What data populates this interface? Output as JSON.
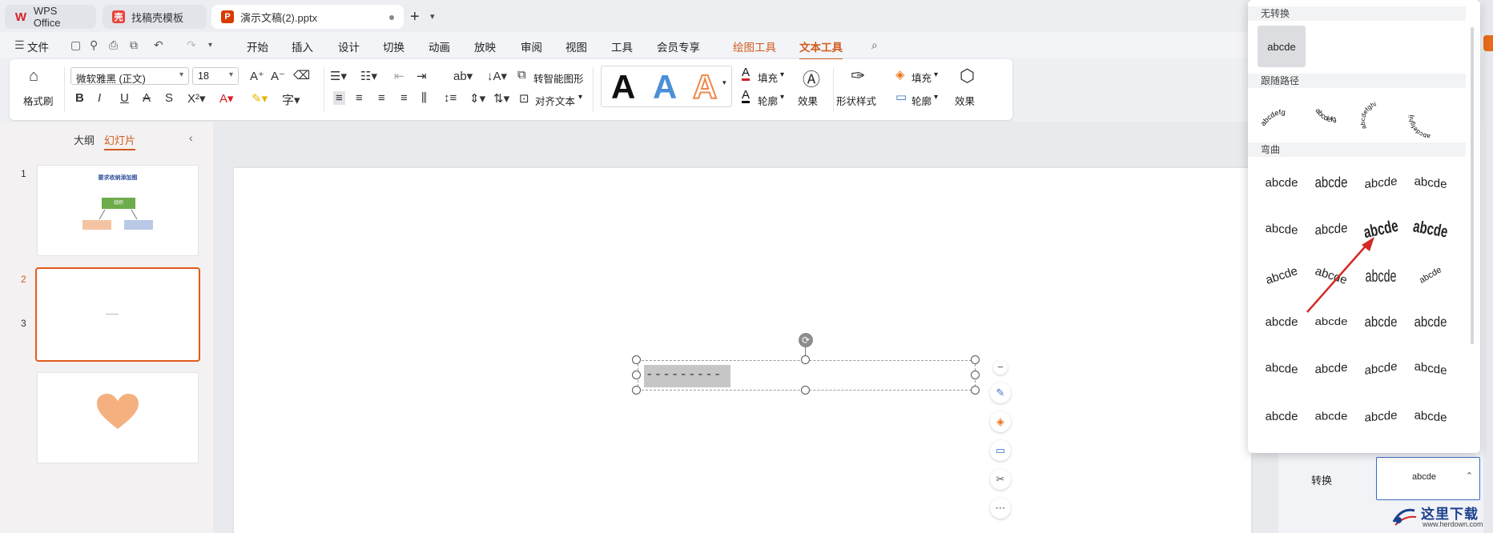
{
  "tabs": [
    {
      "label": "WPS Office",
      "icon": "wps-logo-icon"
    },
    {
      "label": "找稿壳模板",
      "icon": "template-icon"
    },
    {
      "label": "演示文稿(2).pptx",
      "icon": "pptx-icon"
    }
  ],
  "menu": {
    "file": "文件",
    "items": [
      "开始",
      "插入",
      "设计",
      "切换",
      "动画",
      "放映",
      "审阅",
      "视图",
      "工具",
      "会员专享",
      "绘图工具",
      "文本工具"
    ]
  },
  "ribbon": {
    "format_painter": "格式刷",
    "font_name": "微软雅黑 (正文)",
    "font_size": "18",
    "smart_art": "转智能图形",
    "align_text": "对齐文本",
    "fill": "填充",
    "outline": "轮廓",
    "effects": "效果",
    "shape_style": "形状样式",
    "shape_fill": "填充",
    "shape_outline": "轮廓",
    "shape_effects": "效果",
    "gallery_letter": "A",
    "colors": {
      "black": "#111111",
      "blue": "#4a8fd8",
      "orange": "#f0884a"
    }
  },
  "leftpanel": {
    "outline_tab": "大纲",
    "slides_tab": "幻灯片",
    "slides": [
      {
        "num": "1",
        "title": "要求收纳添加图",
        "box": "组织"
      },
      {
        "num": "2"
      },
      {
        "num": "3"
      }
    ]
  },
  "canvas": {
    "textbox_text": "---------"
  },
  "rightpanel": {
    "label": "转换",
    "value": "abcde"
  },
  "transform_menu": {
    "sections": [
      "无转换",
      "跟随路径",
      "弯曲"
    ],
    "sample": "abcde",
    "path_samples": [
      "abcdefg",
      "abcdefg",
      "abcdefghi",
      "abcdefghij"
    ],
    "curve_samples": [
      [
        "abcde",
        "abcde",
        "abcde",
        "abcde"
      ],
      [
        "abcde",
        "abcde",
        "abcde",
        "abcde"
      ],
      [
        "abcde",
        "abcde",
        "abcde",
        "abcde"
      ],
      [
        "abcde",
        "abcde",
        "abcde",
        "abcde"
      ],
      [
        "abcde",
        "abcde",
        "abcde",
        "abcde"
      ],
      [
        "abcde",
        "abcde",
        "abcde",
        "abcde"
      ]
    ]
  },
  "watermark": {
    "title": "这里下载",
    "url": "www.herdown.com"
  }
}
